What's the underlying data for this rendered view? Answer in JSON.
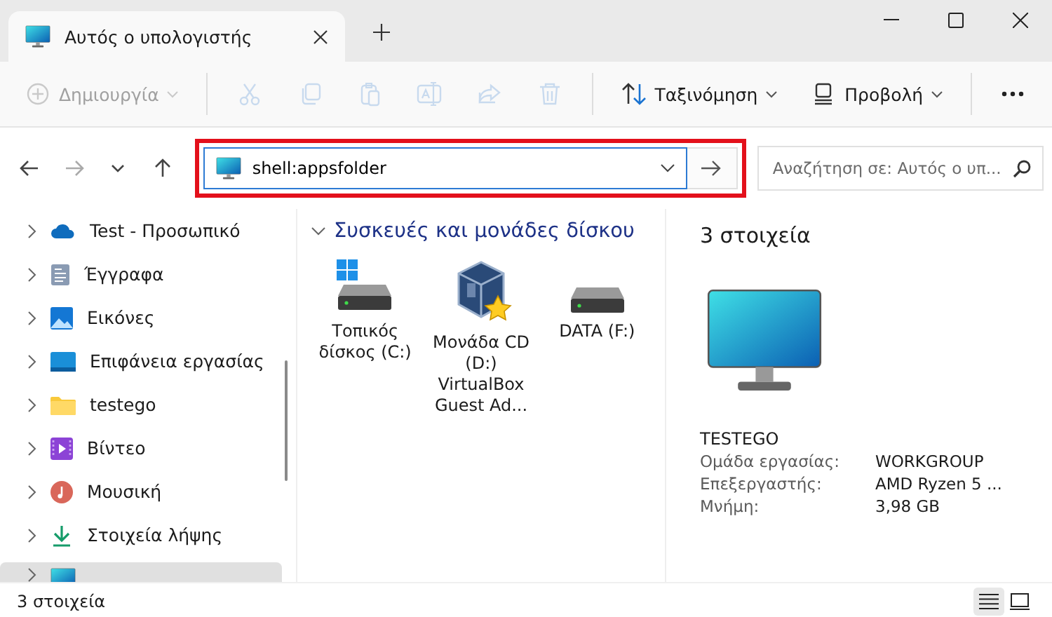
{
  "window": {
    "tab_title": "Αυτός ο υπολογιστής"
  },
  "toolbar": [
    {
      "kind": "new",
      "label": "Δημιουργία",
      "disabled": true
    },
    {
      "kind": "cut",
      "disabled": true
    },
    {
      "kind": "copy",
      "disabled": true
    },
    {
      "kind": "paste",
      "disabled": true
    },
    {
      "kind": "rename",
      "disabled": true
    },
    {
      "kind": "share",
      "disabled": true
    },
    {
      "kind": "delete",
      "disabled": true
    },
    {
      "kind": "sort",
      "label": "Ταξινόμηση",
      "disabled": false
    },
    {
      "kind": "view",
      "label": "Προβολή",
      "disabled": false
    },
    {
      "kind": "more",
      "disabled": false
    }
  ],
  "nav": [
    {
      "kind": "back",
      "disabled": false
    },
    {
      "kind": "forward",
      "disabled": true
    },
    {
      "kind": "recent",
      "disabled": false
    },
    {
      "kind": "up",
      "disabled": false
    }
  ],
  "address": {
    "value": "shell:appsfolder",
    "highlighted": true
  },
  "search": {
    "placeholder": "Αναζήτηση σε: Αυτός ο υπ..."
  },
  "sidebar": {
    "items": [
      {
        "kind": "cloud",
        "label": "Test - Προσωπικό",
        "selected": false
      },
      {
        "kind": "documents",
        "label": "Έγγραφα",
        "selected": false
      },
      {
        "kind": "pictures",
        "label": "Εικόνες",
        "selected": false
      },
      {
        "kind": "desktop",
        "label": "Επιφάνεια εργασίας",
        "selected": false
      },
      {
        "kind": "folder",
        "label": "testego",
        "selected": false
      },
      {
        "kind": "videos",
        "label": "Βίντεο",
        "selected": false
      },
      {
        "kind": "music",
        "label": "Μουσική",
        "selected": false
      },
      {
        "kind": "downloads",
        "label": "Στοιχεία λήψης",
        "selected": false
      },
      {
        "kind": "computer",
        "selected": true
      }
    ]
  },
  "content": {
    "group_title": "Συσκευές και μονάδες δίσκου",
    "expanded": true,
    "drives": [
      {
        "kind": "system",
        "label": "Τοπικός δίσκος (C:)"
      },
      {
        "kind": "cd",
        "label": "Μονάδα CD (D:) VirtualBox Guest Ad..."
      },
      {
        "kind": "disk",
        "label": "DATA (F:)"
      }
    ]
  },
  "details": {
    "title": "3 στοιχεία",
    "name": "TESTEGO",
    "properties": [
      {
        "label": "Ομάδα εργασίας:",
        "value": "WORKGROUP"
      },
      {
        "label": "Επεξεργαστής:",
        "value": "AMD Ryzen 5 ..."
      },
      {
        "label": "Μνήμη:",
        "value": "3,98 GB"
      }
    ]
  },
  "status_bar": {
    "text": "3 στοιχεία",
    "views": [
      {
        "kind": "details",
        "selected": true
      },
      {
        "kind": "tiles",
        "selected": false
      }
    ]
  }
}
